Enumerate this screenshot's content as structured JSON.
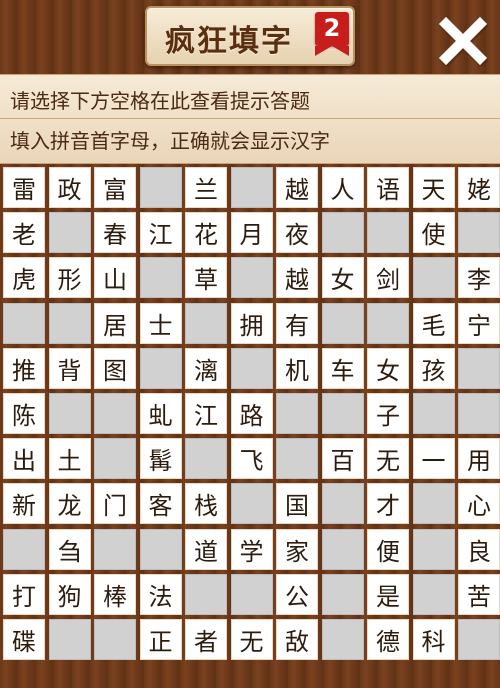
{
  "header": {
    "title": "疯狂填字",
    "badge": "2",
    "close_icon": "close-x-icon"
  },
  "hint": {
    "line1": "请选择下方空格在此查看提示答题",
    "line2": "填入拼音首字母，正确就会显示汉字"
  },
  "colors": {
    "wood": "#6a3718",
    "filled_cell": "#ffffff",
    "blank_cell": "#d1d1d1",
    "badge": "#c81d1d"
  },
  "grid": {
    "rows": [
      [
        "雷",
        "政",
        "富",
        "",
        "兰",
        "",
        "越",
        "人",
        "语",
        "天",
        "姥"
      ],
      [
        "老",
        "",
        "春",
        "江",
        "花",
        "月",
        "夜",
        "",
        "",
        "使",
        ""
      ],
      [
        "虎",
        "形",
        "山",
        "",
        "草",
        "",
        "越",
        "女",
        "剑",
        "",
        "李"
      ],
      [
        "",
        "",
        "居",
        "士",
        "",
        "拥",
        "有",
        "",
        "",
        "毛",
        "宁"
      ],
      [
        "推",
        "背",
        "图",
        "",
        "漓",
        "",
        "机",
        "车",
        "女",
        "孩",
        ""
      ],
      [
        "陈",
        "",
        "",
        "虬",
        "江",
        "路",
        "",
        "",
        "子",
        "",
        ""
      ],
      [
        "出",
        "土",
        "",
        "髯",
        "",
        "飞",
        "",
        "百",
        "无",
        "一",
        "用"
      ],
      [
        "新",
        "龙",
        "门",
        "客",
        "栈",
        "",
        "国",
        "",
        "才",
        "",
        "心"
      ],
      [
        "",
        "刍",
        "",
        "",
        "道",
        "学",
        "家",
        "",
        "便",
        "",
        "良"
      ],
      [
        "打",
        "狗",
        "棒",
        "法",
        "",
        "",
        "公",
        "",
        "是",
        "",
        "苦"
      ],
      [
        "碟",
        "",
        "",
        "正",
        "者",
        "无",
        "敌",
        "",
        "德",
        "科",
        ""
      ]
    ]
  }
}
